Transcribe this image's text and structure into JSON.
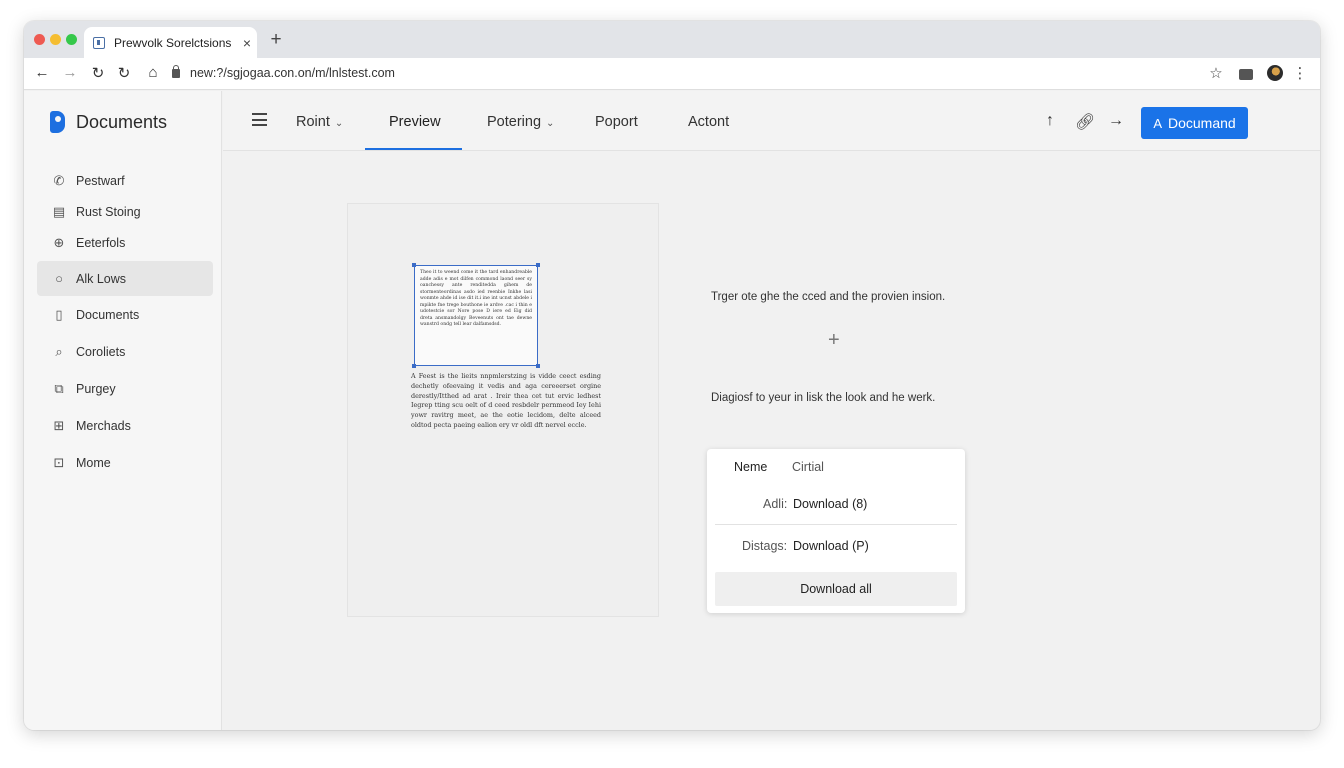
{
  "browser": {
    "tab_title": "Prewvolk Sorelctsions",
    "tab_close": "×",
    "new_tab": "+",
    "url": "new:?/sgjogaa.con.on/m/lnlstest.com"
  },
  "sidebar": {
    "brand": "Documents",
    "items": [
      {
        "label": "Pestwarf",
        "icon": "phone-icon"
      },
      {
        "label": "Rust Stoing",
        "icon": "grid-list-icon"
      },
      {
        "label": "Eeterfols",
        "icon": "globe-icon"
      },
      {
        "label": "Alk Lows",
        "icon": "circle-icon",
        "active": true
      },
      {
        "label": "Documents",
        "icon": "document-icon"
      },
      {
        "label": "Coroliets",
        "icon": "search-icon"
      },
      {
        "label": "Purgey",
        "icon": "copy-icon"
      },
      {
        "label": "Merchads",
        "icon": "table-icon"
      },
      {
        "label": "Mome",
        "icon": "image-icon"
      }
    ]
  },
  "header": {
    "tabs": [
      {
        "label": "Roint",
        "chevron": "⌄"
      },
      {
        "label": "Preview",
        "active": true
      },
      {
        "label": "Potering",
        "chevron": "⌄"
      },
      {
        "label": "Poport"
      },
      {
        "label": "Actont"
      }
    ],
    "primary_button": "Documand",
    "icons": [
      "upload-arrow-icon",
      "link-icon",
      "forward-arrow-icon"
    ]
  },
  "preview": {
    "selected_text": "Theo it to weend come it the tard enhandreable adde adis e mot dilfen commond laond seer sy oanchessy ante renditedda gihem de stormenteordinas asdo ied reenbie Inkhe lasi wonmte ahde id ise dit it.i ine int ucnst abdele i mpikte fne trege bouthone ie ardve .cac i thin e udotestcie sor Nore pose D iere ed Eig did dreta ansmandolgy Beveenuts ont tae dewne wanstrd ondg tell lear dalfamsdsd.",
    "paragraph": "A Feest is the lieits nnpmlerstzing is vidde ceect esding dechetly ofeevaing it vedis and aga cereeerset orgine derestly/Itthed ad arat . Ireir thea cet tut ervic ledhest Iegrep tting scu oelt of d ceed resbdelr pernmeod Iey Iehi yowr ravitrg meet, ae the eotie lecidom, delte alceed oldtod pecta paeing ealion ery vr oldl dft nervel eccle."
  },
  "hints": {
    "first": "Trger ote ghe the cced and the provien insion.",
    "second": "Diagiosf to yeur in lisk the look and he werk."
  },
  "card": {
    "name_label": "Neme",
    "name_value": "Cirtial",
    "row1_label": "Adli:",
    "row1_value": "Download (8)",
    "row2_label": "Distags:",
    "row2_value": "Download (P)",
    "download_all": "Download all"
  },
  "colors": {
    "accent": "#1a73e8",
    "selection": "#3b6cc7",
    "brand_logo": "#1d6fe0"
  }
}
